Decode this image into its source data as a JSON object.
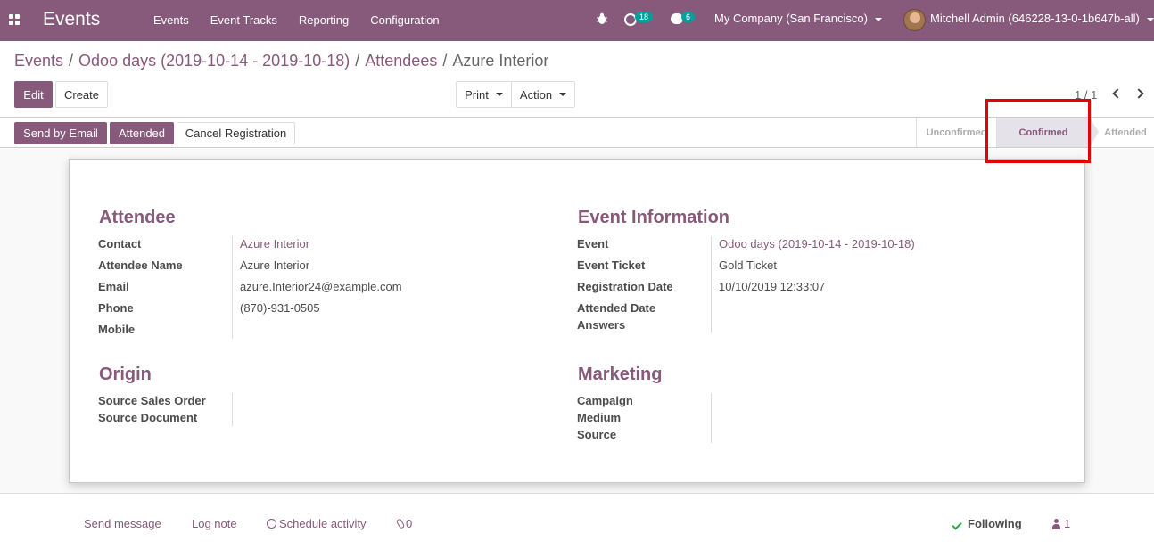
{
  "navbar": {
    "brand": "Events",
    "menu": [
      "Events",
      "Event Tracks",
      "Reporting",
      "Configuration"
    ],
    "activity_count": "18",
    "message_count": "6",
    "company": "My Company (San Francisco)",
    "user": "Mitchell Admin (646228-13-0-1b647b-all)"
  },
  "breadcrumb": {
    "items": [
      "Events",
      "Odoo days (2019-10-14 - 2019-10-18)",
      "Attendees"
    ],
    "current": "Azure Interior",
    "separator": "/"
  },
  "toolbar": {
    "edit_label": "Edit",
    "create_label": "Create",
    "print_label": "Print",
    "action_label": "Action",
    "pager": "1 / 1"
  },
  "statusbar": {
    "send_by_email_label": "Send by Email",
    "attended_label": "Attended",
    "cancel_label": "Cancel Registration",
    "stages": [
      "Unconfirmed",
      "Confirmed",
      "Attended"
    ],
    "current_stage": "Confirmed"
  },
  "form": {
    "attendee": {
      "title": "Attendee",
      "contact_label": "Contact",
      "contact_value": "Azure Interior",
      "name_label": "Attendee Name",
      "name_value": "Azure Interior",
      "email_label": "Email",
      "email_value": "azure.Interior24@example.com",
      "phone_label": "Phone",
      "phone_value": "(870)-931-0505",
      "mobile_label": "Mobile"
    },
    "event_info": {
      "title": "Event Information",
      "event_label": "Event",
      "event_value": "Odoo days (2019-10-14 - 2019-10-18)",
      "ticket_label": "Event Ticket",
      "ticket_value": "Gold Ticket",
      "reg_date_label": "Registration Date",
      "reg_date_value": "10/10/2019 12:33:07",
      "attended_date_label": "Attended Date",
      "answers_label": "Answers"
    },
    "origin": {
      "title": "Origin",
      "sale_order_label": "Source Sales Order",
      "source_doc_label": "Source Document"
    },
    "marketing": {
      "title": "Marketing",
      "campaign_label": "Campaign",
      "medium_label": "Medium",
      "source_label": "Source"
    }
  },
  "chatter": {
    "send_message": "Send message",
    "log_note": "Log note",
    "schedule_activity": "Schedule activity",
    "attachments": "0",
    "following": "Following",
    "followers": "1"
  },
  "colors": {
    "brand": "#875a7b",
    "badge": "#00a09d",
    "highlight": "#e60000",
    "check": "#28a745"
  }
}
